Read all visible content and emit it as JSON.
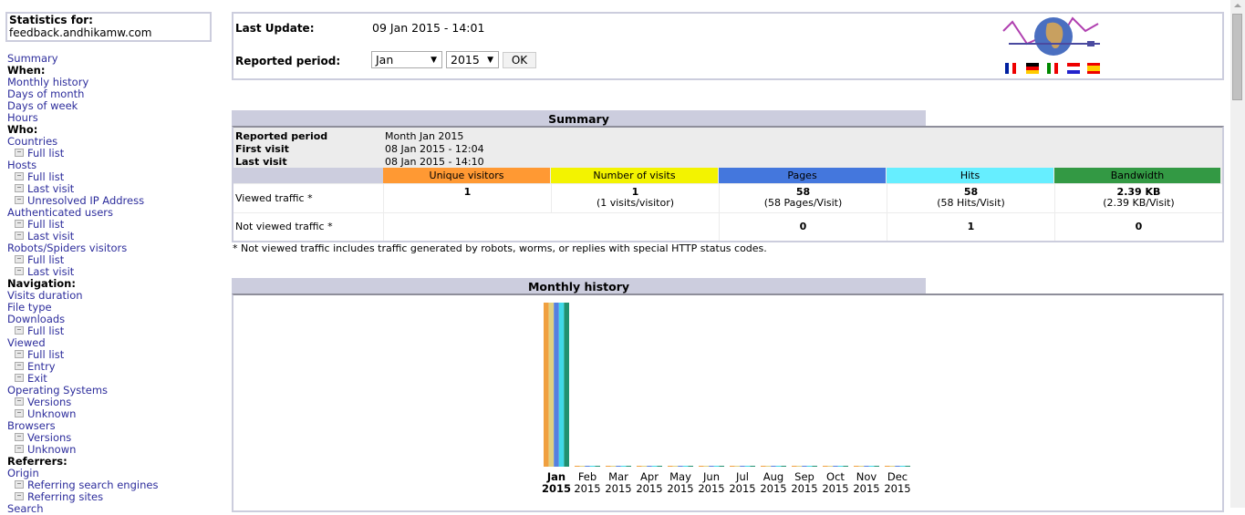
{
  "sidebar": {
    "stats_for_label": "Statistics for:",
    "site": "feedback.andhikamw.com",
    "items": [
      {
        "type": "link",
        "label": "Summary"
      },
      {
        "type": "head",
        "label": "When:"
      },
      {
        "type": "link",
        "label": "Monthly history"
      },
      {
        "type": "link",
        "label": "Days of month"
      },
      {
        "type": "link",
        "label": "Days of week"
      },
      {
        "type": "link",
        "label": "Hours"
      },
      {
        "type": "head",
        "label": "Who:"
      },
      {
        "type": "link",
        "label": "Countries"
      },
      {
        "type": "sub",
        "label": "Full list"
      },
      {
        "type": "link",
        "label": "Hosts"
      },
      {
        "type": "sub",
        "label": "Full list"
      },
      {
        "type": "sub",
        "label": "Last visit"
      },
      {
        "type": "sub",
        "label": "Unresolved IP Address"
      },
      {
        "type": "link",
        "label": "Authenticated users"
      },
      {
        "type": "sub",
        "label": "Full list"
      },
      {
        "type": "sub",
        "label": "Last visit"
      },
      {
        "type": "link",
        "label": "Robots/Spiders visitors"
      },
      {
        "type": "sub",
        "label": "Full list"
      },
      {
        "type": "sub",
        "label": "Last visit"
      },
      {
        "type": "head",
        "label": "Navigation:"
      },
      {
        "type": "link",
        "label": "Visits duration"
      },
      {
        "type": "link",
        "label": "File type"
      },
      {
        "type": "link",
        "label": "Downloads"
      },
      {
        "type": "sub",
        "label": "Full list"
      },
      {
        "type": "link",
        "label": "Viewed"
      },
      {
        "type": "sub",
        "label": "Full list"
      },
      {
        "type": "sub",
        "label": "Entry"
      },
      {
        "type": "sub",
        "label": "Exit"
      },
      {
        "type": "link",
        "label": "Operating Systems"
      },
      {
        "type": "sub",
        "label": "Versions"
      },
      {
        "type": "sub",
        "label": "Unknown"
      },
      {
        "type": "link",
        "label": "Browsers"
      },
      {
        "type": "sub",
        "label": "Versions"
      },
      {
        "type": "sub",
        "label": "Unknown"
      },
      {
        "type": "head",
        "label": "Referrers:"
      },
      {
        "type": "link",
        "label": "Origin"
      },
      {
        "type": "sub",
        "label": "Referring search engines"
      },
      {
        "type": "sub",
        "label": "Referring sites"
      },
      {
        "type": "link",
        "label": "Search"
      }
    ]
  },
  "header": {
    "last_update_label": "Last Update:",
    "last_update_value": "09 Jan 2015 - 14:01",
    "reported_period_label": "Reported period:",
    "month_selected": "Jan",
    "year_selected": "2015",
    "ok_label": "OK",
    "flags": [
      "fr",
      "de",
      "it",
      "nl",
      "es"
    ]
  },
  "summary": {
    "title": "Summary",
    "reported_period_label": "Reported period",
    "reported_period_value": "Month Jan 2015",
    "first_visit_label": "First visit",
    "first_visit_value": "08 Jan 2015 - 12:04",
    "last_visit_label": "Last visit",
    "last_visit_value": "08 Jan 2015 - 14:10",
    "columns": [
      {
        "label": "Unique visitors",
        "color": "#ff9933"
      },
      {
        "label": "Number of visits",
        "color": "#f3f300"
      },
      {
        "label": "Pages",
        "color": "#4477dd"
      },
      {
        "label": "Hits",
        "color": "#66eeff"
      },
      {
        "label": "Bandwidth",
        "color": "#339944"
      }
    ],
    "viewed_label": "Viewed traffic *",
    "viewed": [
      {
        "value": "1",
        "sub": ""
      },
      {
        "value": "1",
        "sub": "(1 visits/visitor)"
      },
      {
        "value": "58",
        "sub": "(58 Pages/Visit)"
      },
      {
        "value": "58",
        "sub": "(58 Hits/Visit)"
      },
      {
        "value": "2.39 KB",
        "sub": "(2.39 KB/Visit)"
      }
    ],
    "not_viewed_label": "Not viewed traffic *",
    "not_viewed": [
      "0",
      "1",
      "0"
    ],
    "footnote": "* Not viewed traffic includes traffic generated by robots, worms, or replies with special HTTP status codes."
  },
  "chart_data": {
    "type": "bar",
    "title": "Monthly history",
    "categories": [
      "Jan",
      "Feb",
      "Mar",
      "Apr",
      "May",
      "Jun",
      "Jul",
      "Aug",
      "Sep",
      "Oct",
      "Nov",
      "Dec"
    ],
    "year": "2015",
    "highlight": "Jan",
    "series": [
      {
        "name": "Unique visitors",
        "color": "#f0a040",
        "values": [
          1,
          0,
          0,
          0,
          0,
          0,
          0,
          0,
          0,
          0,
          0,
          0
        ]
      },
      {
        "name": "Number of visits",
        "color": "#e0d080",
        "values": [
          1,
          0,
          0,
          0,
          0,
          0,
          0,
          0,
          0,
          0,
          0,
          0
        ]
      },
      {
        "name": "Pages",
        "color": "#5580e0",
        "values": [
          58,
          0,
          0,
          0,
          0,
          0,
          0,
          0,
          0,
          0,
          0,
          0
        ]
      },
      {
        "name": "Hits",
        "color": "#40d8e8",
        "values": [
          58,
          0,
          0,
          0,
          0,
          0,
          0,
          0,
          0,
          0,
          0,
          0
        ]
      },
      {
        "name": "Bandwidth (KB)",
        "color": "#209070",
        "values": [
          2.39,
          0,
          0,
          0,
          0,
          0,
          0,
          0,
          0,
          0,
          0,
          0
        ]
      }
    ]
  }
}
